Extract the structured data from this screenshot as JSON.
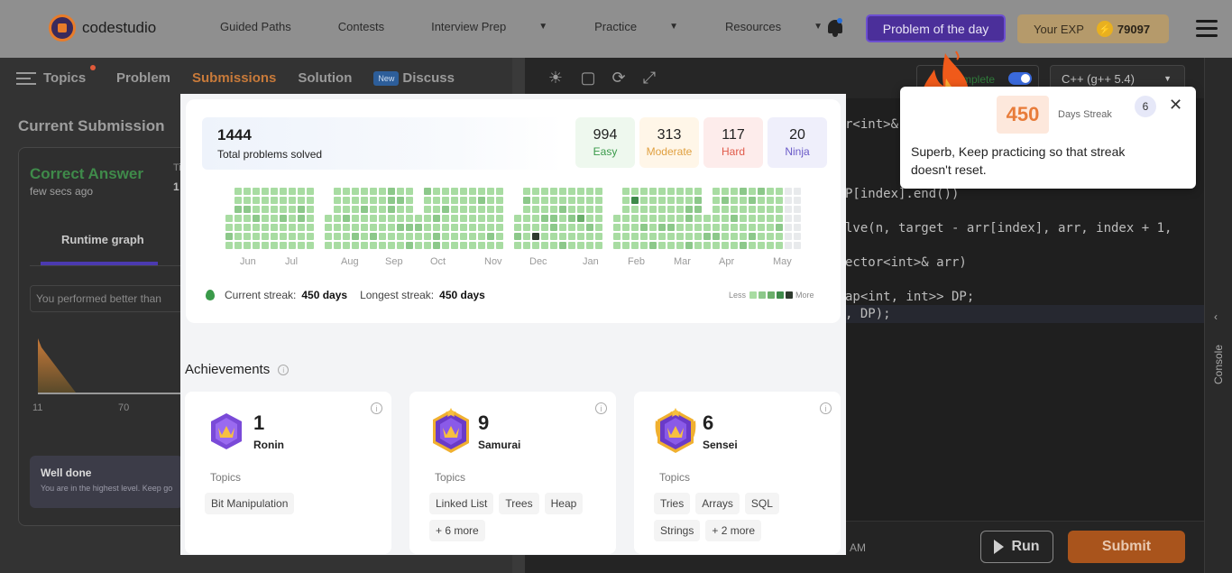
{
  "header": {
    "brand": "codestudio",
    "nav": [
      {
        "label": "Guided Paths",
        "dropdown": false
      },
      {
        "label": "Contests",
        "dropdown": false
      },
      {
        "label": "Interview Prep",
        "dropdown": true
      },
      {
        "label": "Practice",
        "dropdown": true
      },
      {
        "label": "Resources",
        "dropdown": true
      }
    ],
    "potd_label": "Problem of the day",
    "exp_label": "Your EXP",
    "exp_value": "79097"
  },
  "tabs": {
    "topics": "Topics",
    "problem": "Problem",
    "submissions": "Submissions",
    "solution": "Solution",
    "new_badge": "New",
    "discuss": "Discuss"
  },
  "submission": {
    "title": "Current Submission",
    "status": "Correct Answer",
    "time": "few secs ago",
    "tlabel": "Ti",
    "tvalue": "1",
    "runtime_graph": "Runtime graph",
    "better_than": "You performed better than",
    "x_ticks": [
      "11",
      "70"
    ],
    "well_done_title": "Well done",
    "well_done_text": "You are in the highest level. Keep going"
  },
  "editor": {
    "complete_label": "mplete",
    "language": "C++ (g++ 5.4)",
    "lines": [
      {
        "text": "r<int>&",
        "top": 130
      },
      {
        "text": "P[index].end())",
        "top": 207
      },
      {
        "text": "lve(n, target - arr[index], arr, index + 1,",
        "top": 245
      },
      {
        "text": "ector<int>& arr)",
        "top": 283
      },
      {
        "text": "ap<int, int>> DP;",
        "top": 321
      },
      {
        "text": ", DP);",
        "top": 340
      }
    ],
    "time_suffix": "AM",
    "run_label": "Run",
    "submit_label": "Submit",
    "console_label": "Console"
  },
  "stats": {
    "total_value": "1444",
    "total_label": "Total problems solved",
    "difficulty": [
      {
        "value": "994",
        "label": "Easy",
        "bg": "#eef8ee",
        "color": "#3a9a4a"
      },
      {
        "value": "313",
        "label": "Moderate",
        "bg": "#fff6e8",
        "color": "#e0a040"
      },
      {
        "value": "117",
        "label": "Hard",
        "bg": "#fdeceb",
        "color": "#e05a4a"
      },
      {
        "value": "20",
        "label": "Ninja",
        "bg": "#efeffb",
        "color": "#6a5ac8"
      }
    ],
    "months": [
      "Jun",
      "Jul",
      "Aug",
      "Sep",
      "Oct",
      "Nov",
      "Dec",
      "Jan",
      "Feb",
      "Mar",
      "Apr",
      "May"
    ],
    "current_streak_label": "Current streak:",
    "current_streak": "450 days",
    "longest_streak_label": "Longest streak:",
    "longest_streak": "450 days",
    "legend_less": "Less",
    "legend_more": "More",
    "heat_colors": [
      "#a8dca2",
      "#8cc88a",
      "#6aae6a",
      "#3e8a4a",
      "#2e3a2e",
      "#e8eaec"
    ]
  },
  "achievements": {
    "title": "Achievements",
    "cards": [
      {
        "count": "1",
        "rank": "Ronin",
        "topics_label": "Topics",
        "topics": [
          "Bit Manipulation"
        ]
      },
      {
        "count": "9",
        "rank": "Samurai",
        "topics_label": "Topics",
        "topics": [
          "Linked List",
          "Trees",
          "Heap",
          "+ 6 more"
        ]
      },
      {
        "count": "6",
        "rank": "Sensei",
        "topics_label": "Topics",
        "topics": [
          "Tries",
          "Arrays",
          "SQL",
          "Strings",
          "+ 2 more"
        ]
      }
    ]
  },
  "toast": {
    "streak": "450",
    "streak_label": "Days Streak",
    "level": "6",
    "message": "Superb, Keep practicing so that streak doesn't reset."
  }
}
